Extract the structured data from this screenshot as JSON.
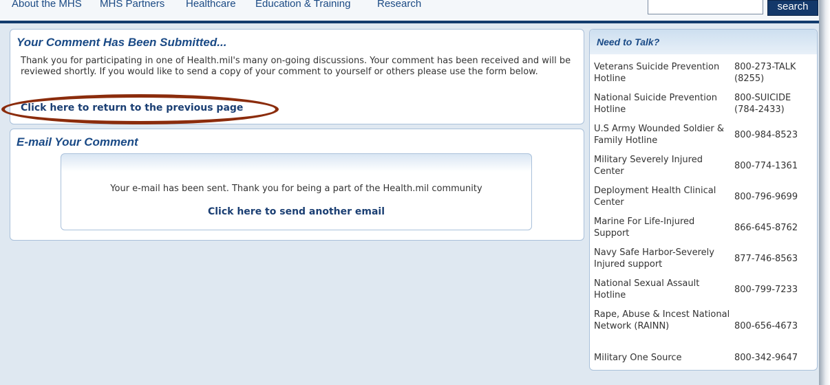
{
  "nav": {
    "items": [
      "About the MHS",
      "MHS Partners",
      "Healthcare",
      "Education & Training",
      "Research"
    ],
    "search_button": "search"
  },
  "submitted": {
    "title": "Your Comment Has Been Submitted...",
    "body": "Thank you for participating in one of Health.mil's many on-going discussions. Your comment has been received and will be reviewed shortly. If you would like to send a copy of your comment to yourself or others please use the form below.",
    "return_link": "Click here to return to the previous page"
  },
  "email": {
    "title": "E-mail Your Comment",
    "message": "Your e-mail has been sent. Thank you for being a part of the Health.mil community",
    "send_another_link": "Click here to send another email"
  },
  "need_to_talk": {
    "title": "Need to Talk?",
    "hotlines": [
      {
        "name": "Veterans Suicide Prevention Hotline",
        "phone": "800-273-TALK (8255)"
      },
      {
        "name": "National Suicide Prevention Hotline",
        "phone": "800-SUICIDE (784-2433)"
      },
      {
        "name": "U.S Army Wounded Soldier & Family Hotline",
        "phone": "800-984-8523"
      },
      {
        "name": "Military Severely Injured Center",
        "phone": "800-774-1361"
      },
      {
        "name": "Deployment Health Clinical Center",
        "phone": "800-796-9699"
      },
      {
        "name": "Marine For Life-Injured Support",
        "phone": "866-645-8762"
      },
      {
        "name": "Navy Safe Harbor-Severely Injured support",
        "phone": "877-746-8563"
      },
      {
        "name": "National Sexual Assault Hotline",
        "phone": "800-799-7233"
      },
      {
        "name": "Rape, Abuse & Incest National Network (RAINN)",
        "phone": "800-656-4673"
      },
      {
        "name": "Military One Source",
        "phone": "800-342-9647"
      }
    ]
  },
  "colors": {
    "brand_blue": "#1a4a86",
    "nav_bar": "#123b6d",
    "highlight_oval": "#8b2c0c"
  }
}
